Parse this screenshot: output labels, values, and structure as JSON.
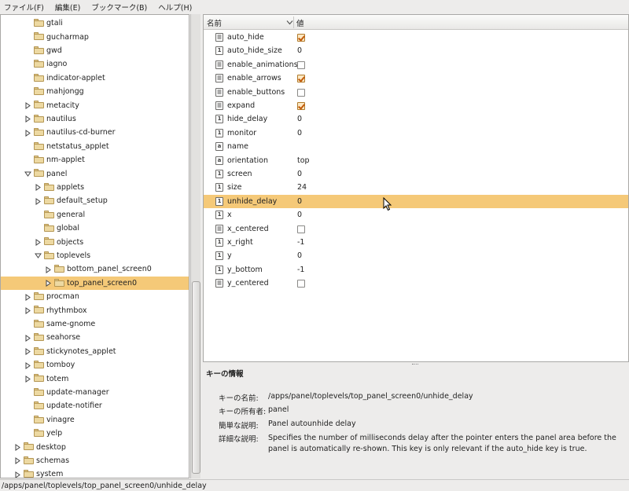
{
  "menubar": {
    "items": [
      "ファイル(F)",
      "編集(E)",
      "ブックマーク(B)",
      "ヘルプ(H)"
    ]
  },
  "tree": {
    "rows": [
      {
        "label": "gtali",
        "expandable": false,
        "expanded": false,
        "selected": false
      },
      {
        "label": "gucharmap",
        "expandable": false,
        "expanded": false,
        "selected": false
      },
      {
        "label": "gwd",
        "expandable": false,
        "expanded": false,
        "selected": false
      },
      {
        "label": "iagno",
        "expandable": false,
        "expanded": false,
        "selected": false
      },
      {
        "label": "indicator-applet",
        "expandable": false,
        "expanded": false,
        "selected": false
      },
      {
        "label": "mahjongg",
        "expandable": false,
        "expanded": false,
        "selected": false
      },
      {
        "label": "metacity",
        "expandable": true,
        "expanded": false,
        "selected": false
      },
      {
        "label": "nautilus",
        "expandable": true,
        "expanded": false,
        "selected": false
      },
      {
        "label": "nautilus-cd-burner",
        "expandable": true,
        "expanded": false,
        "selected": false
      },
      {
        "label": "netstatus_applet",
        "expandable": false,
        "expanded": false,
        "selected": false
      },
      {
        "label": "nm-applet",
        "expandable": false,
        "expanded": false,
        "selected": false
      },
      {
        "label": "panel",
        "expandable": true,
        "expanded": true,
        "selected": false
      },
      {
        "label": "applets",
        "expandable": true,
        "expanded": false,
        "selected": false
      },
      {
        "label": "default_setup",
        "expandable": true,
        "expanded": false,
        "selected": false
      },
      {
        "label": "general",
        "expandable": false,
        "expanded": false,
        "selected": false
      },
      {
        "label": "global",
        "expandable": false,
        "expanded": false,
        "selected": false
      },
      {
        "label": "objects",
        "expandable": true,
        "expanded": false,
        "selected": false
      },
      {
        "label": "toplevels",
        "expandable": true,
        "expanded": true,
        "selected": false
      },
      {
        "label": "bottom_panel_screen0",
        "expandable": true,
        "expanded": false,
        "selected": false
      },
      {
        "label": "top_panel_screen0",
        "expandable": true,
        "expanded": false,
        "selected": true
      },
      {
        "label": "procman",
        "expandable": true,
        "expanded": false,
        "selected": false
      },
      {
        "label": "rhythmbox",
        "expandable": true,
        "expanded": false,
        "selected": false
      },
      {
        "label": "same-gnome",
        "expandable": false,
        "expanded": false,
        "selected": false
      },
      {
        "label": "seahorse",
        "expandable": true,
        "expanded": false,
        "selected": false
      },
      {
        "label": "stickynotes_applet",
        "expandable": true,
        "expanded": false,
        "selected": false
      },
      {
        "label": "tomboy",
        "expandable": true,
        "expanded": false,
        "selected": false
      },
      {
        "label": "totem",
        "expandable": true,
        "expanded": false,
        "selected": false
      },
      {
        "label": "update-manager",
        "expandable": false,
        "expanded": false,
        "selected": false
      },
      {
        "label": "update-notifier",
        "expandable": false,
        "expanded": false,
        "selected": false
      },
      {
        "label": "vinagre",
        "expandable": false,
        "expanded": false,
        "selected": false
      },
      {
        "label": "yelp",
        "expandable": false,
        "expanded": false,
        "selected": false
      },
      {
        "label": "desktop",
        "expandable": true,
        "expanded": false,
        "selected": false
      },
      {
        "label": "schemas",
        "expandable": true,
        "expanded": false,
        "selected": false
      },
      {
        "label": "system",
        "expandable": true,
        "expanded": false,
        "selected": false
      }
    ]
  },
  "keys": {
    "name_header": "名前",
    "value_header": "値",
    "rows": [
      {
        "name": "auto_hide",
        "type": "bool",
        "value": true,
        "selected": false
      },
      {
        "name": "auto_hide_size",
        "type": "int",
        "value": "0",
        "selected": false
      },
      {
        "name": "enable_animations",
        "type": "bool",
        "value": false,
        "selected": false
      },
      {
        "name": "enable_arrows",
        "type": "bool",
        "value": true,
        "selected": false
      },
      {
        "name": "enable_buttons",
        "type": "bool",
        "value": false,
        "selected": false
      },
      {
        "name": "expand",
        "type": "bool",
        "value": true,
        "selected": false
      },
      {
        "name": "hide_delay",
        "type": "int",
        "value": "0",
        "selected": false
      },
      {
        "name": "monitor",
        "type": "int",
        "value": "0",
        "selected": false
      },
      {
        "name": "name",
        "type": "string",
        "value": "",
        "selected": false
      },
      {
        "name": "orientation",
        "type": "string",
        "value": "top",
        "selected": false
      },
      {
        "name": "screen",
        "type": "int",
        "value": "0",
        "selected": false
      },
      {
        "name": "size",
        "type": "int",
        "value": "24",
        "selected": false
      },
      {
        "name": "unhide_delay",
        "type": "int",
        "value": "0",
        "selected": true
      },
      {
        "name": "x",
        "type": "int",
        "value": "0",
        "selected": false
      },
      {
        "name": "x_centered",
        "type": "bool",
        "value": false,
        "selected": false
      },
      {
        "name": "x_right",
        "type": "int",
        "value": "-1",
        "selected": false
      },
      {
        "name": "y",
        "type": "int",
        "value": "0",
        "selected": false
      },
      {
        "name": "y_bottom",
        "type": "int",
        "value": "-1",
        "selected": false
      },
      {
        "name": "y_centered",
        "type": "bool",
        "value": false,
        "selected": false
      }
    ]
  },
  "info": {
    "title": "キーの情報",
    "key_name_label": "キーの名前:",
    "key_name_value": "/apps/panel/toplevels/top_panel_screen0/unhide_delay",
    "owner_label": "キーの所有者:",
    "owner_value": "panel",
    "short_desc_label": "簡単な説明:",
    "short_desc_value": "Panel autounhide delay",
    "long_desc_label": "詳細な説明:",
    "long_desc_value": "Specifies the number of milliseconds delay after the pointer enters the panel area before the panel is automatically re-shown. This key is only relevant if the auto_hide key is true."
  },
  "statusbar": {
    "path": "/apps/panel/toplevels/top_panel_screen0/unhide_delay"
  },
  "icons": {
    "folder_color": "#edd9a2",
    "selection_color": "#f5c978"
  }
}
